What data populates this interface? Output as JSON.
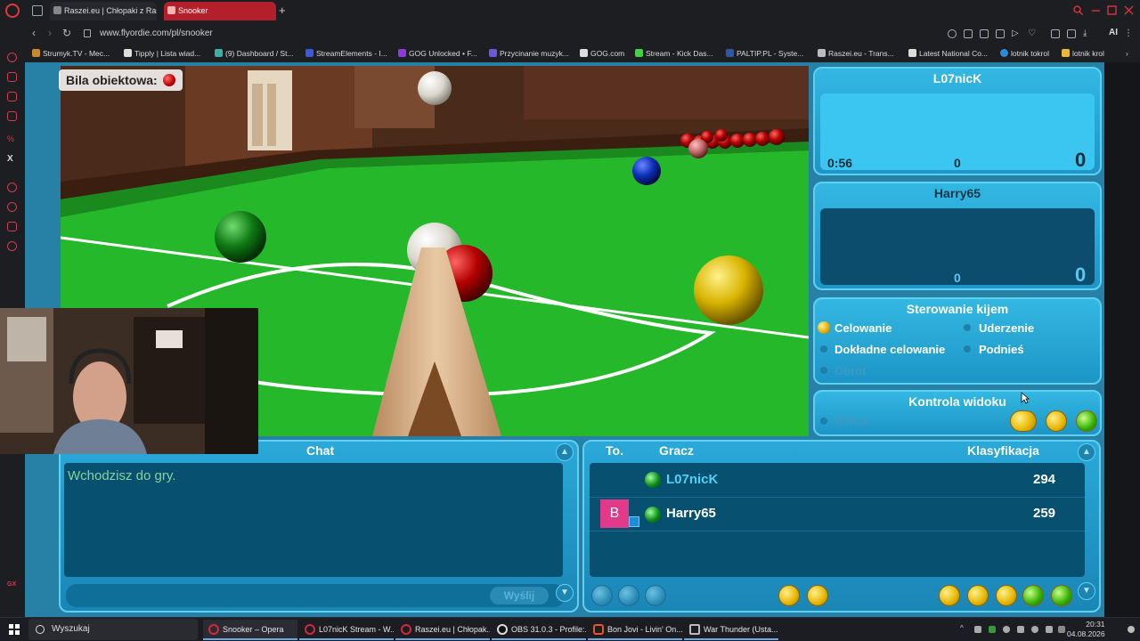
{
  "browser": {
    "tabs": [
      {
        "label": "Raszei.eu | Chłopaki z Ras"
      },
      {
        "label": "Snooker"
      }
    ],
    "url": "www.flyordie.com/pl/snooker",
    "ai_label": "AI",
    "bookmarks": [
      "Strumyk.TV - Mec...",
      "Tipply | Lista wiad...",
      "(9) Dashboard / St...",
      "StreamElements - I...",
      "GOG Unlocked • F...",
      "Przycinanie muzyk...",
      "GOG.com",
      "Stream - Kick Das...",
      "PALTIP.PL - Syste...",
      "Raszei.eu - Trans...",
      "Latest National Co...",
      "lotnik tokrol",
      "lotnik krol"
    ]
  },
  "game": {
    "object_ball_label": "Bila obiektowa:",
    "player1": {
      "name": "L07nicK",
      "timer": "0:56",
      "break": "0",
      "score": "0"
    },
    "player2": {
      "name": "Harry65",
      "break": "0",
      "score": "0"
    },
    "cue_control": {
      "title": "Sterowanie kijem",
      "options": [
        "Celowanie",
        "Uderzenie",
        "Dokładne celowanie",
        "Podnieś",
        "Obrót"
      ],
      "selected": "Celowanie"
    },
    "view_control": {
      "title": "Kontrola widoku",
      "option": "Widok"
    },
    "chat": {
      "title": "Chat",
      "message": "Wchodzisz do gry.",
      "send_label": "Wyślij"
    },
    "players_list": {
      "col_to": "To.",
      "col_player": "Gracz",
      "col_rank": "Klasyfikacja",
      "rows": [
        {
          "name": "L07nicK",
          "rank": "294",
          "badge": ""
        },
        {
          "name": "Harry65",
          "rank": "259",
          "badge": "B"
        }
      ]
    }
  },
  "taskbar": {
    "search_placeholder": "Wyszukaj",
    "items": [
      "Snooker – Opera",
      "L07nicK Stream - W...",
      "Raszei.eu | Chłopak...",
      "OBS 31.0.3 - Profile:...",
      "Bon Jovi - Livin' On...",
      "War Thunder (Usta..."
    ],
    "time": "20:31",
    "date": "04.08.2026"
  }
}
